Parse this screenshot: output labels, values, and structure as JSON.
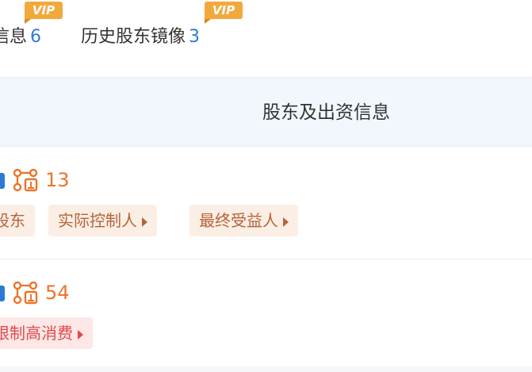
{
  "tabs": [
    {
      "label": "信息",
      "count": "6",
      "badge": "VIP"
    },
    {
      "label": "历史股东镜像",
      "count": "3",
      "badge": "VIP"
    }
  ],
  "section": {
    "title": "股东及出资信息"
  },
  "rows": [
    {
      "relation_count": "13",
      "tags": [
        {
          "label": "股东"
        },
        {
          "label": "实际控制人"
        },
        {
          "label": "最终受益人"
        }
      ]
    },
    {
      "relation_count": "54",
      "tags": [
        {
          "label": "限制高消费"
        }
      ]
    }
  ],
  "colors": {
    "accent_blue": "#2b7bd6",
    "vip_orange": "#f2a93b",
    "count_orange": "#e9752b",
    "tag_text": "#b4643a",
    "tag_bg": "#fbeee4",
    "risk_red": "#e04a4a",
    "risk_bg": "#fde7e7",
    "header_bg": "#f2f7fd"
  }
}
